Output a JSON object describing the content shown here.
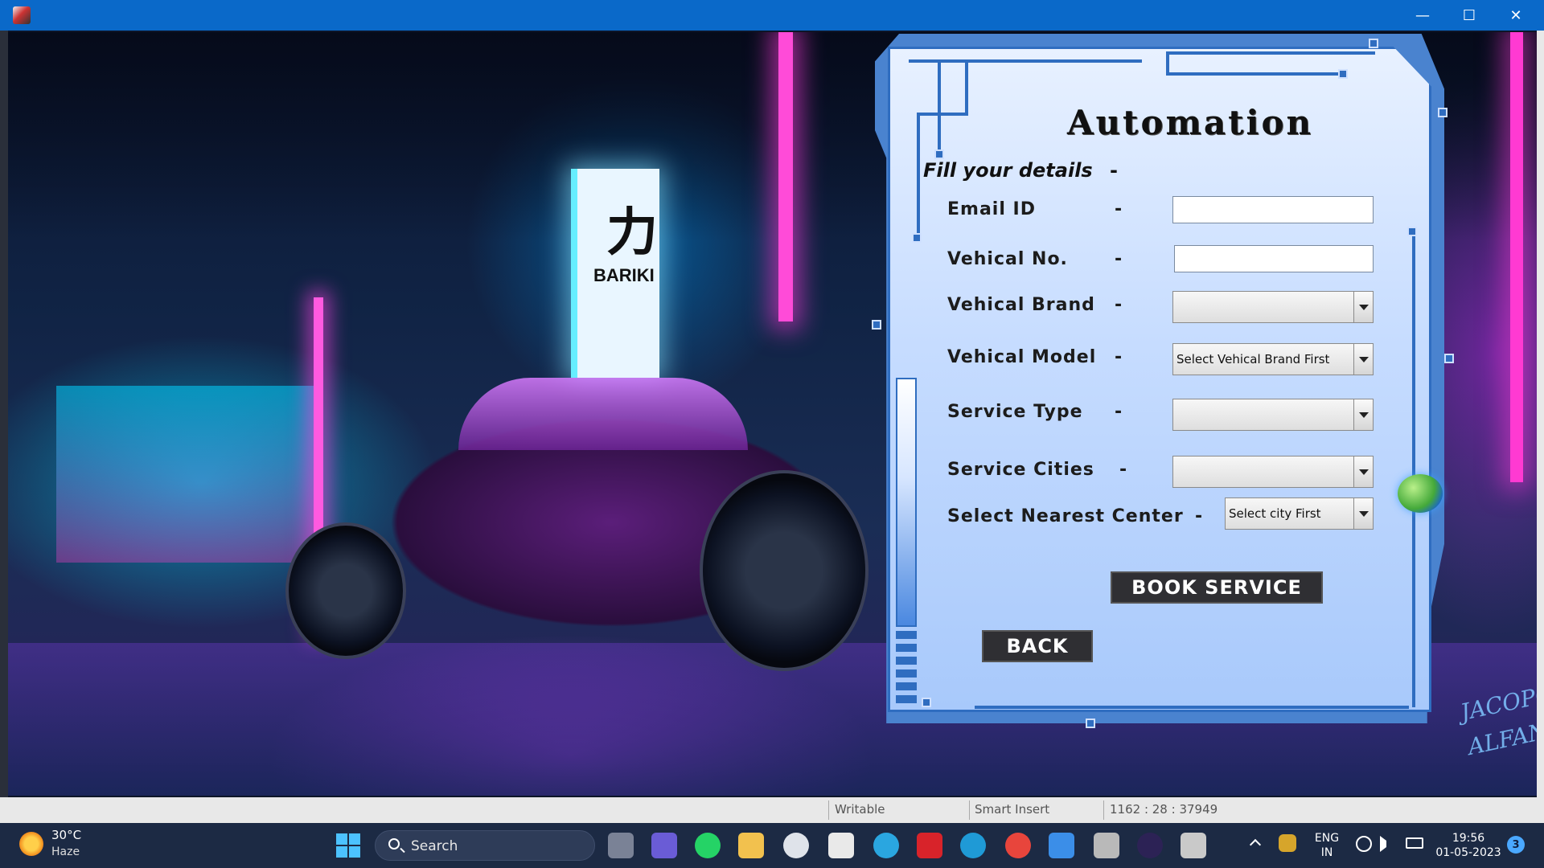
{
  "window": {
    "controls": {
      "minimize": "—",
      "maximize": "☐",
      "close": "✕"
    }
  },
  "background": {
    "sign_text": "BARIKI",
    "sign_glyph": "力",
    "signature_line1": "JACOPO",
    "signature_line2": "ALFANO"
  },
  "form": {
    "title": "Automation",
    "subtitle": "Fill your details",
    "subtitle_dash": "-",
    "fields": [
      {
        "label": "Email ID",
        "dash": "-",
        "value": ""
      },
      {
        "label": "Vehical No.",
        "dash": "-",
        "value": ""
      },
      {
        "label": "Vehical Brand",
        "dash": "-",
        "value": ""
      },
      {
        "label": "Vehical Model",
        "dash": "-",
        "value": "Select Vehical Brand First"
      },
      {
        "label": "Service Type",
        "dash": "-",
        "value": ""
      },
      {
        "label": "Service Cities",
        "dash": "-",
        "value": ""
      },
      {
        "label": "Select Nearest Center",
        "dash": "-",
        "value": "Select city First"
      }
    ],
    "book_button": "BOOK SERVICE",
    "back_button": "BACK"
  },
  "statusbar": {
    "mode": "Writable",
    "insert": "Smart Insert",
    "position": "1162 : 28 : 37949"
  },
  "taskbar": {
    "weather_temp": "30°C",
    "weather_desc": "Haze",
    "search_label": "Search",
    "lang_line1": "ENG",
    "lang_line2": "IN",
    "time": "19:56",
    "date": "01-05-2023",
    "notification_count": "3"
  }
}
